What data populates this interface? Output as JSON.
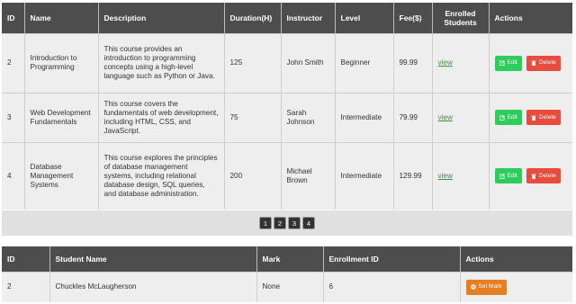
{
  "courses": {
    "headers": [
      "ID",
      "Name",
      "Description",
      "Duration(H)",
      "Instructor",
      "Level",
      "Fee($)",
      "Enrolled Students",
      "Actions"
    ],
    "rows": [
      {
        "id": "2",
        "name": "Introduction to Programming",
        "description": "This course provides an introduction to programming concepts using a high-level language such as Python or Java.",
        "duration": "125",
        "instructor": "John Smith",
        "level": "Beginner",
        "fee": "99.99",
        "enrolled": "view",
        "edit": "Edit",
        "delete": "Delete"
      },
      {
        "id": "3",
        "name": "Web Development Fundamentals",
        "description": "This course covers the fundamentals of web development, including HTML, CSS, and JavaScript.",
        "duration": "75",
        "instructor": "Sarah Johnson",
        "level": "Intermediate",
        "fee": "79.99",
        "enrolled": "view",
        "edit": "Edit",
        "delete": "Delete"
      },
      {
        "id": "4",
        "name": "Database Management Systems",
        "description": "This course explores the principles of database management systems, including relational database design, SQL queries, and database administration.",
        "duration": "200",
        "instructor": "Michael Brown",
        "level": "Intermediate",
        "fee": "129.99",
        "enrolled": "view",
        "edit": "Edit",
        "delete": "Delete"
      }
    ]
  },
  "pagination": {
    "pages": [
      "1",
      "2",
      "3",
      "4"
    ]
  },
  "students": {
    "headers": [
      "ID",
      "Student Name",
      "Mark",
      "Enrollment ID",
      "Actions"
    ],
    "rows": [
      {
        "id": "2",
        "name": "Chuckles McLaugherson",
        "mark": "None",
        "enrollment_id": "6",
        "action": "Set Mark"
      }
    ]
  },
  "colors": {
    "header_bg": "#4d4d4d",
    "edit_button": "#2ecc5a",
    "delete_button": "#e74c3c",
    "set_mark_button": "#e67e22",
    "link": "#4a8a4a"
  },
  "icons": {
    "edit": "edit-square-icon",
    "delete": "trash-icon",
    "set_mark": "plus-circle-icon"
  }
}
